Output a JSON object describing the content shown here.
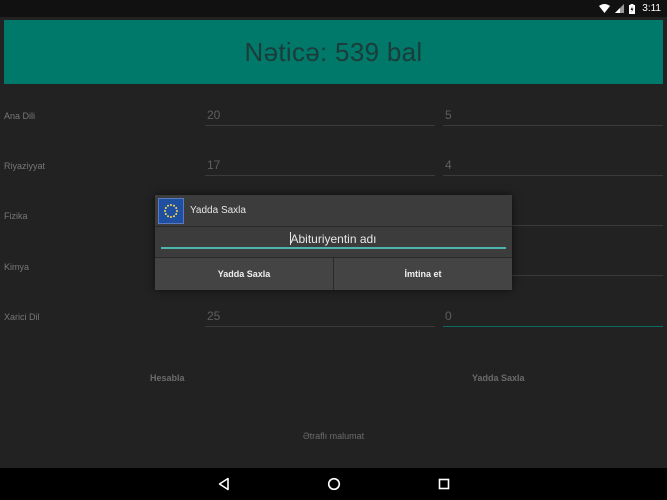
{
  "status_bar": {
    "time": "3:11",
    "icons": [
      "wifi-icon",
      "signal-icon",
      "battery-icon"
    ]
  },
  "result": {
    "text": "Nəticə: 539 bal"
  },
  "rows": [
    {
      "label": "Ana Dili",
      "value1": "20",
      "value2": "5"
    },
    {
      "label": "Riyaziyyat",
      "value1": "17",
      "value2": "4"
    },
    {
      "label": "Fizika",
      "value1": "",
      "value2": ""
    },
    {
      "label": "Kimya",
      "value1": "",
      "value2": ""
    },
    {
      "label": "Xarici Dil",
      "value1": "25",
      "value2": "0"
    }
  ],
  "actions": {
    "calculate": "Hesabla",
    "save": "Yadda Saxla",
    "more_info": "Ətraflı malumat"
  },
  "dialog": {
    "title": "Yadda Saxla",
    "input_value": "Abituriyentin adı",
    "confirm": "Yadda Saxla",
    "cancel": "İmtina et"
  },
  "nav": {
    "icons": [
      "back-icon",
      "home-icon",
      "recents-icon"
    ]
  },
  "colors": {
    "accent": "#00796b",
    "input_underline": "#4db6ac",
    "background": "#222222"
  }
}
